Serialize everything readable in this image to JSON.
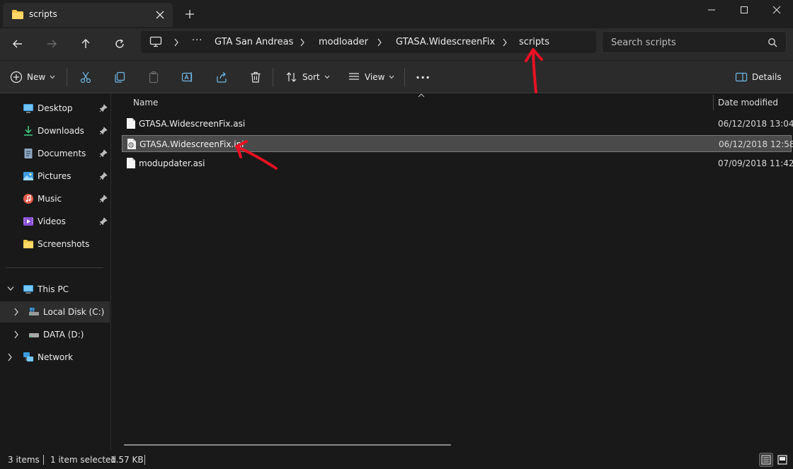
{
  "window": {
    "tab_title": "scripts",
    "new_tab": "+"
  },
  "address": {
    "overflow": "···",
    "crumbs": [
      "GTA San Andreas",
      "modloader",
      "GTASA.WidescreenFix",
      "scripts"
    ]
  },
  "search": {
    "placeholder": "Search scripts"
  },
  "toolbar": {
    "new_label": "New",
    "sort_label": "Sort",
    "view_label": "View",
    "more_label": "···",
    "details_label": "Details"
  },
  "sidebar": {
    "quick_access": [
      {
        "label": "Desktop",
        "icon": "desktop-icon",
        "pinned": true
      },
      {
        "label": "Downloads",
        "icon": "downloads-icon",
        "pinned": true
      },
      {
        "label": "Documents",
        "icon": "documents-icon",
        "pinned": true
      },
      {
        "label": "Pictures",
        "icon": "pictures-icon",
        "pinned": true
      },
      {
        "label": "Music",
        "icon": "music-icon",
        "pinned": true
      },
      {
        "label": "Videos",
        "icon": "videos-icon",
        "pinned": true
      },
      {
        "label": "Screenshots",
        "icon": "folder-icon",
        "pinned": false
      }
    ],
    "this_pc": "This PC",
    "drives": [
      "Local Disk (C:)",
      "DATA (D:)"
    ],
    "network": "Network"
  },
  "columns": {
    "name": "Name",
    "date_modified": "Date modified"
  },
  "files": [
    {
      "name": "GTASA.WidescreenFix.asi",
      "date": "06/12/2018 13:04",
      "selected": false,
      "type": "asi"
    },
    {
      "name": "GTASA.WidescreenFix.ini",
      "date": "06/12/2018 12:58",
      "selected": true,
      "type": "ini"
    },
    {
      "name": "modupdater.asi",
      "date": "07/09/2018 11:42",
      "selected": false,
      "type": "asi"
    }
  ],
  "status": {
    "item_count": "3 items",
    "selected": "1 item selected",
    "size": "1.57 KB"
  },
  "colors": {
    "accent_folder": "#f4c74a",
    "annotation_red": "#e81123"
  }
}
